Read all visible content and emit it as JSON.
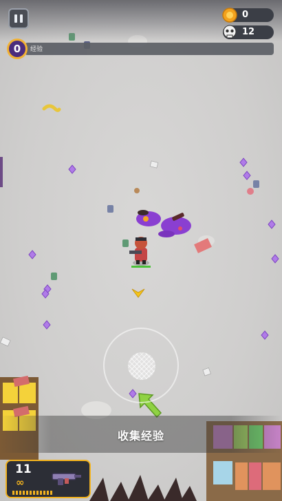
{
  "hud": {
    "coins": "0",
    "kills": "12",
    "level": "0",
    "xp_label": "经验"
  },
  "tutorial": {
    "hint": "收集经验"
  },
  "weapon": {
    "ammo": "11",
    "reserve": "∞"
  },
  "icons": {
    "pause": "pause-icon",
    "coin": "coin-icon",
    "kills": "skull-icon",
    "arrow": "green-arrow-icon",
    "marker": "yellow-chevron-icon",
    "gem": "purple-xp-gem-icon"
  },
  "colors": {
    "gem": "#b07be8",
    "accent": "#f3b31f",
    "level_badge": "#4b2d7d",
    "health_bar": "#4cc13a",
    "enemy": "#8a3fd1"
  }
}
